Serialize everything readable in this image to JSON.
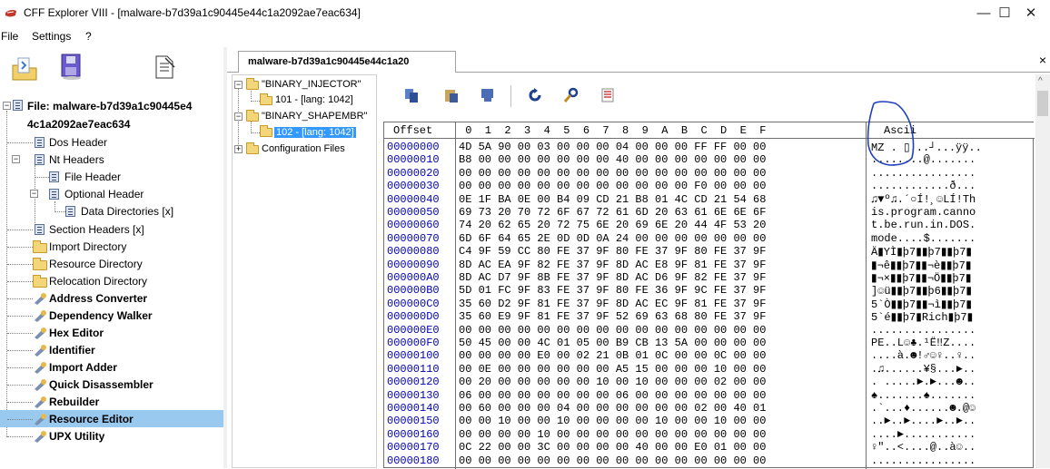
{
  "window": {
    "title": "CFF Explorer VIII - [malware-b7d39a1c90445e44c1a2092ae7eac634]",
    "minimize": "—",
    "maximize": "☐",
    "close": "✕"
  },
  "menu": {
    "items": [
      "File",
      "Settings",
      "?"
    ]
  },
  "tree": {
    "root_line1": "File: malware-b7d39a1c90445e4",
    "root_line2": "4c1a2092ae7eac634",
    "items": [
      {
        "label": "Dos Header"
      },
      {
        "label": "Nt Headers"
      },
      {
        "label": "File Header"
      },
      {
        "label": "Optional Header"
      },
      {
        "label": "Data Directories [x]"
      },
      {
        "label": "Section Headers [x]"
      },
      {
        "label": "Import Directory"
      },
      {
        "label": "Resource Directory"
      },
      {
        "label": "Relocation Directory"
      },
      {
        "label": "Address Converter"
      },
      {
        "label": "Dependency Walker"
      },
      {
        "label": "Hex Editor"
      },
      {
        "label": "Identifier"
      },
      {
        "label": "Import Adder"
      },
      {
        "label": "Quick Disassembler"
      },
      {
        "label": "Rebuilder"
      },
      {
        "label": "Resource Editor"
      },
      {
        "label": "UPX Utility"
      }
    ]
  },
  "tab": {
    "label": "malware-b7d39a1c90445e44c1a20",
    "close": "×"
  },
  "resource_tree": {
    "items": [
      {
        "label": "\"BINARY_INJECTOR\""
      },
      {
        "label": "101 - [lang: 1042]"
      },
      {
        "label": "\"BINARY_SHAPEMBR\""
      },
      {
        "label": "102 - [lang: 1042]"
      },
      {
        "label": "Configuration Files"
      }
    ]
  },
  "hex": {
    "offset_header": "Offset",
    "ascii_header": "Ascii",
    "columns": [
      "0",
      "1",
      "2",
      "3",
      "4",
      "5",
      "6",
      "7",
      "8",
      "9",
      "A",
      "B",
      "C",
      "D",
      "E",
      "F"
    ],
    "rows": [
      {
        "off": "00000000",
        "bytes": "4D 5A 90 00 03 00 00 00 04 00 00 00 FF FF 00 00",
        "ascii": "MZ . ▯...┘...ÿÿ.."
      },
      {
        "off": "00000010",
        "bytes": "B8 00 00 00 00 00 00 00 40 00 00 00 00 00 00 00",
        "ascii": "........@......."
      },
      {
        "off": "00000020",
        "bytes": "00 00 00 00 00 00 00 00 00 00 00 00 00 00 00 00",
        "ascii": "................"
      },
      {
        "off": "00000030",
        "bytes": "00 00 00 00 00 00 00 00 00 00 00 00 F0 00 00 00",
        "ascii": "............ð..."
      },
      {
        "off": "00000040",
        "bytes": "0E 1F BA 0E 00 B4 09 CD 21 B8 01 4C CD 21 54 68",
        "ascii": "♫▼º♫.´○Í!¸☺LÍ!Th"
      },
      {
        "off": "00000050",
        "bytes": "69 73 20 70 72 6F 67 72 61 6D 20 63 61 6E 6E 6F",
        "ascii": "is.program.canno"
      },
      {
        "off": "00000060",
        "bytes": "74 20 62 65 20 72 75 6E 20 69 6E 20 44 4F 53 20",
        "ascii": "t.be.run.in.DOS."
      },
      {
        "off": "00000070",
        "bytes": "6D 6F 64 65 2E 0D 0D 0A 24 00 00 00 00 00 00 00",
        "ascii": "mode....$......."
      },
      {
        "off": "00000080",
        "bytes": "C4 9F 59 CC 80 FE 37 9F 80 FE 37 9F 80 FE 37 9F",
        "ascii": "Ä▮YÌ▮þ7▮▮þ7▮▮þ7▮"
      },
      {
        "off": "00000090",
        "bytes": "8D AC EA 9F 82 FE 37 9F 8D AC E8 9F 81 FE 37 9F",
        "ascii": "▮¬ê▮▮þ7▮▮¬è▮▮þ7▮"
      },
      {
        "off": "000000A0",
        "bytes": "8D AC D7 9F 8B FE 37 9F 8D AC D6 9F 82 FE 37 9F",
        "ascii": "▮¬×▮▮þ7▮▮¬Ö▮▮þ7▮"
      },
      {
        "off": "000000B0",
        "bytes": "5D 01 FC 9F 83 FE 37 9F 80 FE 36 9F 9C FE 37 9F",
        "ascii": "]☺ü▮▮þ7▮▮þ6▮▮þ7▮"
      },
      {
        "off": "000000C0",
        "bytes": "35 60 D2 9F 81 FE 37 9F 8D AC EC 9F 81 FE 37 9F",
        "ascii": "5`Ò▮▮þ7▮▮¬ì▮▮þ7▮"
      },
      {
        "off": "000000D0",
        "bytes": "35 60 E9 9F 81 FE 37 9F 52 69 63 68 80 FE 37 9F",
        "ascii": "5`é▮▮þ7▮Rich▮þ7▮"
      },
      {
        "off": "000000E0",
        "bytes": "00 00 00 00 00 00 00 00 00 00 00 00 00 00 00 00",
        "ascii": "................"
      },
      {
        "off": "000000F0",
        "bytes": "50 45 00 00 4C 01 05 00 B9 CB 13 5A 00 00 00 00",
        "ascii": "PE..L☺♣.¹Ë‼Z...."
      },
      {
        "off": "00000100",
        "bytes": "00 00 00 00 E0 00 02 21 0B 01 0C 00 00 0C 00 00",
        "ascii": "....à.☻!♂☺♀..♀.."
      },
      {
        "off": "00000110",
        "bytes": "00 0E 00 00 00 00 00 00 A5 15 00 00 00 10 00 00",
        "ascii": ".♫......¥§...►.."
      },
      {
        "off": "00000120",
        "bytes": "00 20 00 00 00 00 00 10 00 10 00 00 00 02 00 00",
        "ascii": ". .....►.►...☻.."
      },
      {
        "off": "00000130",
        "bytes": "06 00 00 00 00 00 00 00 06 00 00 00 00 00 00 00",
        "ascii": "♠.......♠......."
      },
      {
        "off": "00000140",
        "bytes": "00 60 00 00 00 04 00 00 00 00 00 00 02 00 40 01",
        "ascii": ".`...♦......☻.@☺"
      },
      {
        "off": "00000150",
        "bytes": "00 00 10 00 00 10 00 00 00 00 10 00 00 10 00 00",
        "ascii": "..►..►....►..►.."
      },
      {
        "off": "00000160",
        "bytes": "00 00 00 00 10 00 00 00 00 00 00 00 00 00 00 00",
        "ascii": "....►..........."
      },
      {
        "off": "00000170",
        "bytes": "0C 22 00 00 3C 00 00 00 00 40 00 00 E0 01 00 00",
        "ascii": "♀\"..<....@..à☺.."
      },
      {
        "off": "00000180",
        "bytes": "00 00 00 00 00 00 00 00 00 00 00 00 00 00 00 00",
        "ascii": "................"
      }
    ]
  },
  "colors": {
    "selection": "#99c9ef",
    "offset_text": "#0000c0",
    "annotation": "#1f3fbf"
  }
}
